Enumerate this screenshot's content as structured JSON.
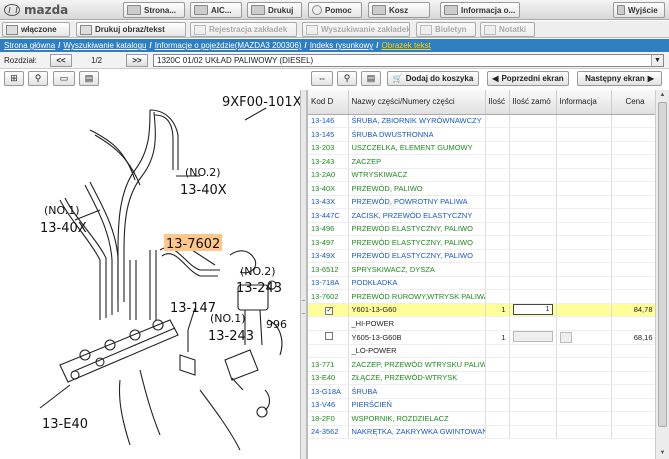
{
  "app": {
    "logo_text": "mazda"
  },
  "topbar": {
    "strona_label": "Strona...",
    "aic_label": "AIC...",
    "drukuj_label": "Drukuj",
    "pomoc_label": "Pomoc",
    "kosz_label": "Kosz",
    "informacja_label": "Informacja o...",
    "wyjscie_label": "Wyjście"
  },
  "toolbar2": {
    "wlaczone_label": "włączone",
    "drukuj_obraz_label": "Drukuj obraz/tekst",
    "rejestracja_label": "Rejestracja zakładek",
    "wyszukiwanie_label": "Wyszukiwanie zakładek",
    "biuletyn_label": "Biuletyn",
    "notatki_label": "Notatki"
  },
  "breadcrumb": {
    "items": [
      "Strona główna",
      "Wyszukiwanie katalogu",
      "Informacje o pojeździe(MAZDA3 200306)",
      "Indeks rysunkowy"
    ],
    "current": "Obrazek tekst",
    "sep": "/"
  },
  "section": {
    "label": "Rozdział:",
    "prev": "<<",
    "next": ">>",
    "page": "1/2",
    "selected": "1320C 01/02 UKŁAD PALIWOWY (DIESEL)"
  },
  "parts_toolbar": {
    "add_to_cart": "Dodaj do koszyka",
    "prev_screen": "Poprzedni ekran",
    "next_screen": "Następny ekran"
  },
  "diagram_labels": {
    "top_code": "9XF00-101X",
    "no2_a": "(NO.2)",
    "c_1340x_a": "13-40X",
    "no1_a": "(NO.1)",
    "c_1340x_b": "13-40X",
    "highlight": "13-7602",
    "no2_b": "(NO.2)",
    "c_13243_a": "13-243",
    "c_13147": "13-147",
    "no1_b": "(NO.1)",
    "c_13243_b": "13-243",
    "c_996": "996",
    "c_13e40": "13-E40"
  },
  "table": {
    "headers": {
      "code": "Kod D",
      "name": "Nazwy części/Numery części",
      "qty": "Ilość",
      "order": "Ilość zamó",
      "info": "Informacja",
      "price": "Cena"
    },
    "rows": [
      {
        "code": "13-146",
        "name": "ŚRUBA, ZBIORNIK WYRÓWNAWCZY",
        "qty": "",
        "price": "",
        "kind": "b"
      },
      {
        "code": "13-145",
        "name": "ŚRUBA DWUSTRONNA",
        "qty": "",
        "price": "",
        "kind": "b"
      },
      {
        "code": "13-203",
        "name": "USZCZELKA, ELEMENT GUMOWY",
        "qty": "",
        "price": "",
        "kind": "g"
      },
      {
        "code": "13-243",
        "name": "ZACZEP",
        "qty": "",
        "price": "",
        "kind": "g"
      },
      {
        "code": "13-2A0",
        "name": "WTRYSKIWACZ",
        "qty": "",
        "price": "",
        "kind": "g"
      },
      {
        "code": "13-40X",
        "name": "PRZEWÓD, PALIWO",
        "qty": "",
        "price": "",
        "kind": "g"
      },
      {
        "code": "13-43X",
        "name": "PRZEWÓD, POWROTNY PALIWA",
        "qty": "",
        "price": "",
        "kind": "b"
      },
      {
        "code": "13-447C",
        "name": "ZACISK, PRZEWÓD ELASTYCZNY",
        "qty": "",
        "price": "",
        "kind": "b"
      },
      {
        "code": "13-496",
        "name": "PRZEWÓD ELASTYCZNY, PALIWO",
        "qty": "",
        "price": "",
        "kind": "g"
      },
      {
        "code": "13-497",
        "name": "PRZEWÓD ELASTYCZNY, PALIWO",
        "qty": "",
        "price": "",
        "kind": "g"
      },
      {
        "code": "13-49X",
        "name": "PRZEWÓD ELASTYCZNY, PALIWO",
        "qty": "",
        "price": "",
        "kind": "b"
      },
      {
        "code": "13-6512",
        "name": "SPRYSKIWACZ, DYSZA",
        "qty": "",
        "price": "",
        "kind": "g"
      },
      {
        "code": "13-718A",
        "name": "PODKŁADKA",
        "qty": "",
        "price": "",
        "kind": "b"
      },
      {
        "code": "13-7602",
        "name": "PRZEWÓD RUROWY,WTRYSK PALIWA",
        "qty": "",
        "price": "",
        "kind": "g"
      },
      {
        "code": "",
        "name": "Y601-13-G60",
        "qty": "1",
        "price": "84,78",
        "kind": "hl",
        "order": "1",
        "checked": "✓"
      },
      {
        "code": "",
        "name": "_HI-POWER",
        "qty": "",
        "price": "",
        "kind": "plain"
      },
      {
        "code": "",
        "name": "Y605-13-G60B",
        "qty": "1",
        "price": "68,16",
        "kind": "dis"
      },
      {
        "code": "",
        "name": "_LO-POWER",
        "qty": "",
        "price": "",
        "kind": "plain"
      },
      {
        "code": "13-771",
        "name": "ZACZEP, PRZEWÓD WTRYSKU PALIWA",
        "qty": "",
        "price": "",
        "kind": "g"
      },
      {
        "code": "13-E40",
        "name": "ZŁĄCZE, PRZEWÓD-WTRYSK",
        "qty": "",
        "price": "",
        "kind": "g"
      },
      {
        "code": "13-G18A",
        "name": "ŚRUBA",
        "qty": "",
        "price": "",
        "kind": "b"
      },
      {
        "code": "13-V46",
        "name": "PIERŚCIEŃ",
        "qty": "",
        "price": "",
        "kind": "b"
      },
      {
        "code": "18-2F0",
        "name": "WSPORNIK, ROZDZIELACZ",
        "qty": "",
        "price": "",
        "kind": "g"
      },
      {
        "code": "24-3562",
        "name": "NAKRĘTKA, ZAKRYWKA GWINTOWANA",
        "qty": "",
        "price": "",
        "kind": "b"
      }
    ]
  },
  "colors": {
    "breadcrumb_bg": "#2d7fc2",
    "highlight_row": "#ffff99",
    "highlight_callout": "#ffc88a"
  }
}
